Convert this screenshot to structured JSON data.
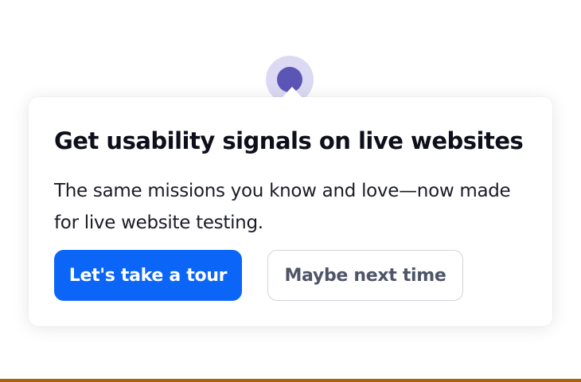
{
  "tour_popover": {
    "title": "Get usability signals on live websites",
    "description": "The same missions you know and love—now made for live website testing.",
    "primary_button_label": "Let's take a tour",
    "secondary_button_label": "Maybe next time"
  },
  "colors": {
    "primary": "#0b66f7",
    "beacon_ring": "#dcd9f3",
    "beacon_dot": "#5b55b5",
    "bottom_bar": "#a8620b"
  }
}
